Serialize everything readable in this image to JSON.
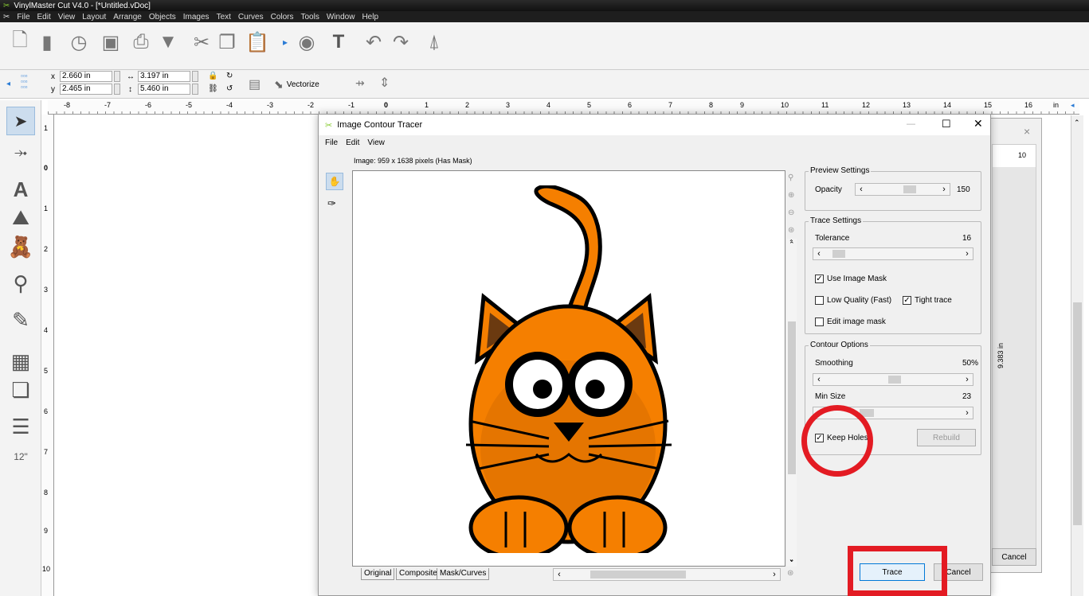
{
  "app": {
    "title": "VinylMaster Cut V4.0 - [*Untitled.vDoc]",
    "menu": [
      "File",
      "Edit",
      "View",
      "Layout",
      "Arrange",
      "Objects",
      "Images",
      "Text",
      "Curves",
      "Colors",
      "Tools",
      "Window",
      "Help"
    ]
  },
  "toolbar2": {
    "x_label": "x",
    "x_value": "2.660 in",
    "y_label": "y",
    "y_value": "2.465 in",
    "width_value": "3.197 in",
    "height_value": "5.460 in",
    "vectorize_label": "Vectorize"
  },
  "ruler": {
    "labels": [
      "-8",
      "-7",
      "-6",
      "-5",
      "-4",
      "-3",
      "-2",
      "-1",
      "0",
      "1",
      "2",
      "3",
      "4",
      "5",
      "6",
      "7",
      "8",
      "9",
      "10",
      "11",
      "12",
      "13",
      "14",
      "15",
      "16"
    ],
    "unit": "in"
  },
  "vruler": {
    "labels": [
      "1",
      "0",
      "1",
      "2",
      "3",
      "4",
      "5",
      "6",
      "7",
      "8",
      "9",
      "10"
    ]
  },
  "back_dialog": {
    "ruler_label": "10",
    "measure": "9.383 in",
    "cancel": "Cancel",
    "close": "×"
  },
  "dialog": {
    "title": "Image Contour Tracer",
    "menu": [
      "File",
      "Edit",
      "View"
    ],
    "image_info": "Image: 959 x 1638 pixels (Has Mask)",
    "preview": {
      "title": "Preview Settings",
      "opacity_label": "Opacity",
      "opacity_value": "150"
    },
    "trace": {
      "title": "Trace Settings",
      "tolerance_label": "Tolerance",
      "tolerance_value": "16",
      "use_mask": "Use Image Mask",
      "low_quality": "Low Quality (Fast)",
      "tight_trace": "Tight trace",
      "edit_mask": "Edit image mask"
    },
    "contour": {
      "title": "Contour Options",
      "smoothing_label": "Smoothing",
      "smoothing_value": "50%",
      "min_size_label": "Min Size",
      "min_size_value": "23",
      "keep_holes": "Keep Holes",
      "rebuild": "Rebuild"
    },
    "tabs": [
      "Original",
      "Composite",
      "Mask/Curves"
    ],
    "trace_button": "Trace",
    "cancel_button": "Cancel"
  },
  "colors": {
    "highlight_red": "#e31b23",
    "cat_orange": "#f57f00"
  }
}
